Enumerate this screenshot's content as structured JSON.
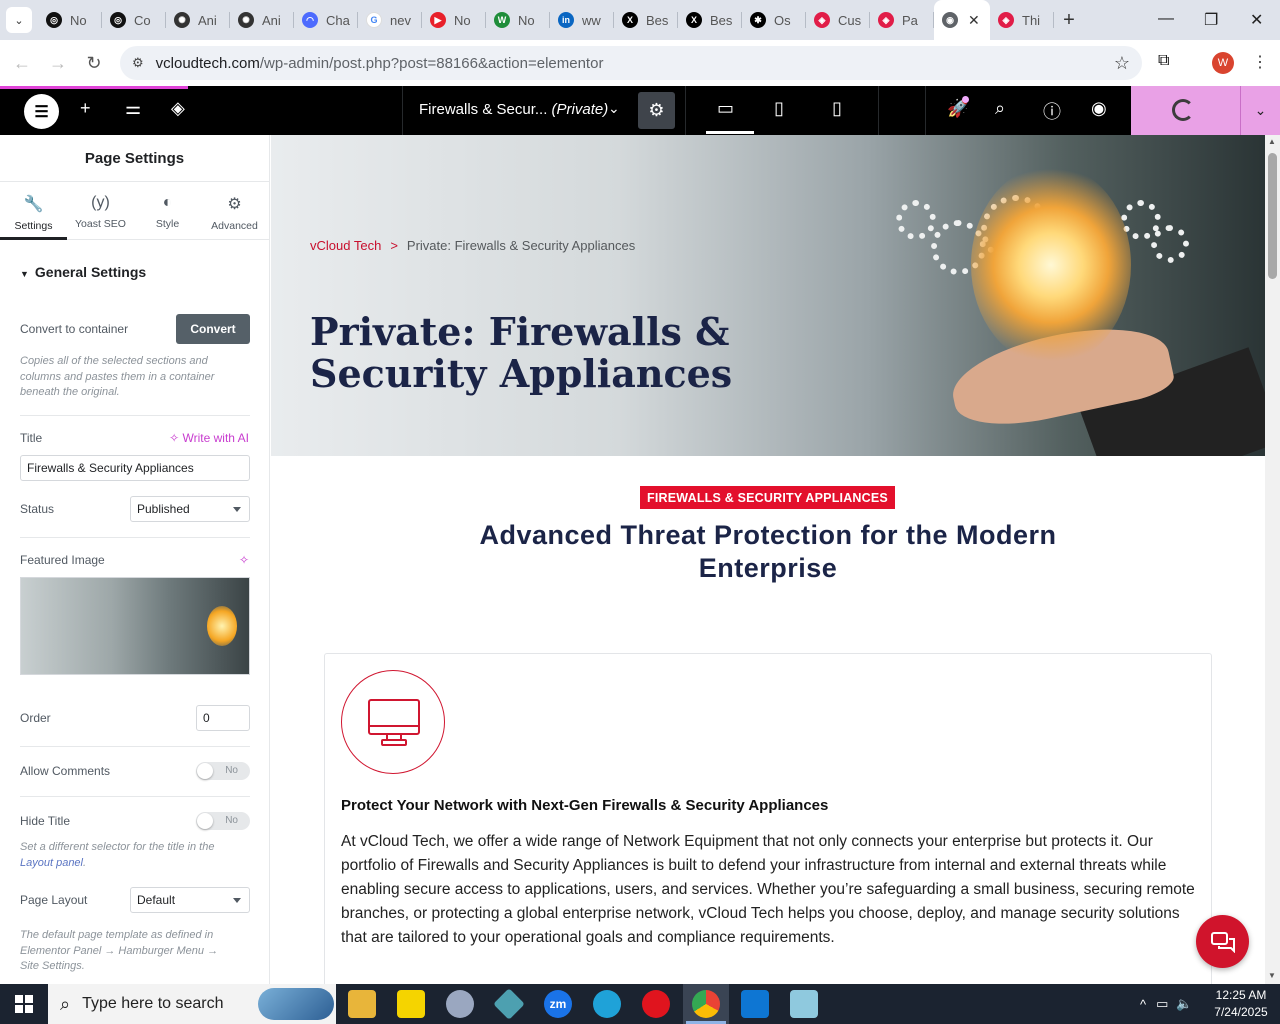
{
  "browser": {
    "tabs": [
      {
        "label": "No",
        "color": "#111111",
        "glyph": "◎"
      },
      {
        "label": "Co",
        "color": "#111111",
        "glyph": "◎"
      },
      {
        "label": "Ani",
        "color": "#333333",
        "glyph": "✺"
      },
      {
        "label": "Ani",
        "color": "#333333",
        "glyph": "✺"
      },
      {
        "label": "Cha",
        "color": "#4d6bfe",
        "glyph": "◠"
      },
      {
        "label": "nev",
        "color": "#ffffff",
        "glyph": "G"
      },
      {
        "label": "No",
        "color": "#e8202a",
        "glyph": "▶"
      },
      {
        "label": "No",
        "color": "#1f8d3a",
        "glyph": "W"
      },
      {
        "label": "ww",
        "color": "#0a66c2",
        "glyph": "in"
      },
      {
        "label": "Bes",
        "color": "#000000",
        "glyph": "X"
      },
      {
        "label": "Bes",
        "color": "#000000",
        "glyph": "X"
      },
      {
        "label": "Os",
        "color": "#000000",
        "glyph": "✱"
      },
      {
        "label": "Cus",
        "color": "#e11d48",
        "glyph": "◈"
      },
      {
        "label": "Pa",
        "color": "#e11d48",
        "glyph": "◈"
      },
      {
        "label": "",
        "color": "#5f6368",
        "glyph": "◉",
        "active": true
      },
      {
        "label": "Thi",
        "color": "#e11d48",
        "glyph": "◈"
      }
    ],
    "url_site": "vcloudtech.com",
    "url_path": "/wp-admin/post.php?post=88166&action=elementor",
    "profile_initial": "W"
  },
  "elementor": {
    "doc_title": "Firewalls & Secur...",
    "doc_status": "(Private)"
  },
  "panel": {
    "header": "Page Settings",
    "tabs": [
      {
        "label": "Settings",
        "icon": "wrench-icon",
        "glyph": "🔧"
      },
      {
        "label": "Yoast SEO",
        "icon": "yoast-icon",
        "glyph": "(y)"
      },
      {
        "label": "Style",
        "icon": "contrast-icon",
        "glyph": "◐"
      },
      {
        "label": "Advanced",
        "icon": "gear-icon",
        "glyph": "⚙"
      }
    ],
    "section_title": "General Settings",
    "convert_label": "Convert to container",
    "convert_button": "Convert",
    "convert_hint": "Copies all of the selected sections and columns and pastes them in a container beneath the original.",
    "title_label": "Title",
    "write_ai": "Write with AI",
    "title_value": "Firewalls & Security Appliances",
    "status_label": "Status",
    "status_value": "Published",
    "featured_label": "Featured Image",
    "order_label": "Order",
    "order_value": "0",
    "allow_comments_label": "Allow Comments",
    "allow_comments_value": "No",
    "hide_title_label": "Hide Title",
    "hide_title_value": "No",
    "hide_title_hint_pre": "Set a different selector for the title in the ",
    "hide_title_hint_link": "Layout panel",
    "hide_title_hint_post": ".",
    "page_layout_label": "Page Layout",
    "page_layout_value": "Default",
    "page_layout_hint": "The default page template as defined in Elementor Panel → Hamburger Menu → Site Settings."
  },
  "page": {
    "breadcrumb_home": "vCloud Tech",
    "breadcrumb_sep": ">",
    "breadcrumb_current": "Private: Firewalls & Security Appliances",
    "hero_title": "Private: Firewalls & Security Appliances",
    "category_badge": "FIREWALLS & SECURITY APPLIANCES",
    "section_heading": "Advanced Threat Protection for the Modern Enterprise",
    "card_title": "Protect Your Network with Next-Gen Firewalls & Security Appliances",
    "card_body": "At vCloud Tech, we offer a wide range of Network Equipment that not only connects your enterprise but protects it. Our portfolio of Firewalls and Security Appliances is built to defend your infrastructure from internal and external threats while enabling secure access to applications, users, and services. Whether you’re safeguarding a small business, securing remote branches, or protecting a global enterprise network, vCloud Tech helps you choose, deploy, and manage security solutions that are tailored to your operational goals and compliance requirements."
  },
  "taskbar": {
    "search_placeholder": "Type here to search",
    "time": "12:25 AM",
    "date": "7/24/2025"
  },
  "colors": {
    "accent_red": "#c8102e",
    "navy": "#1b2447",
    "elementor_pink": "#e9a1e6"
  }
}
